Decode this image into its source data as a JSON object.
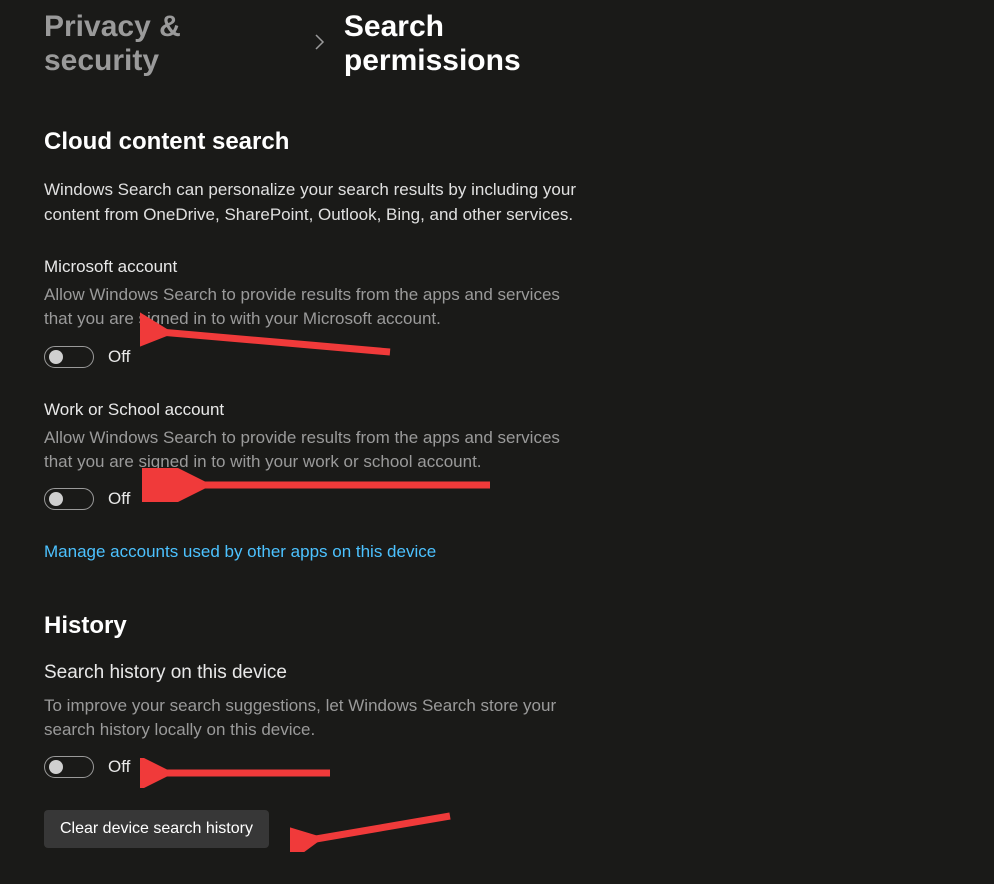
{
  "breadcrumb": {
    "parent": "Privacy & security",
    "current": "Search permissions"
  },
  "sections": {
    "cloud": {
      "heading": "Cloud content search",
      "intro": "Windows Search can personalize your search results by including your content from OneDrive, SharePoint, Outlook, Bing, and other services.",
      "msAccount": {
        "title": "Microsoft account",
        "desc": "Allow Windows Search to provide results from the apps and services that you are signed in to with your Microsoft account.",
        "state": "Off"
      },
      "workAccount": {
        "title": "Work or School account",
        "desc": "Allow Windows Search to provide results from the apps and services that you are signed in to with your work or school account.",
        "state": "Off"
      },
      "manageLink": "Manage accounts used by other apps on this device"
    },
    "history": {
      "heading": "History",
      "searchHistory": {
        "title": "Search history on this device",
        "desc": "To improve your search suggestions, let Windows Search store your search history locally on this device.",
        "state": "Off"
      },
      "clearButton": "Clear device search history"
    }
  }
}
